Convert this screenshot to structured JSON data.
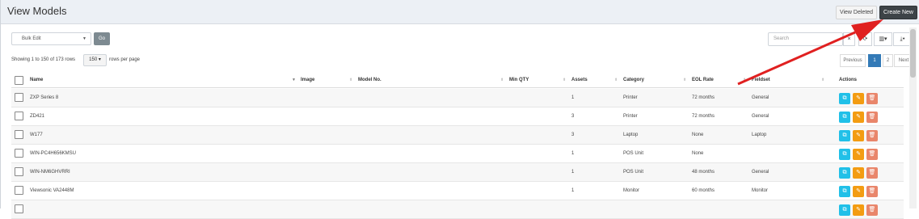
{
  "header": {
    "title": "View Models",
    "view_deleted": "View Deleted",
    "create_new": "Create New"
  },
  "toolbar": {
    "bulk_edit": "Bulk Edit",
    "go": "Go",
    "search_placeholder": "Search",
    "clear": "×",
    "refresh": "⟳",
    "columns": "▥▾",
    "export": "⤓▾"
  },
  "pagination": {
    "showing": "Showing 1 to 150 of 173 rows",
    "per_page_value": "150 ▾",
    "per_page_label": "rows per page",
    "previous": "Previous",
    "page_1": "1",
    "page_2": "2",
    "next": "Next"
  },
  "table": {
    "headers": [
      "Name",
      "Image",
      "Model No.",
      "Min QTY",
      "Assets",
      "Category",
      "EOL Rate",
      "Fieldset",
      "Actions"
    ],
    "rows": [
      {
        "name": "ZXP Series 8",
        "image": "",
        "model_no": "",
        "min_qty": "",
        "assets": "1",
        "category": "Printer",
        "eol": "72 months",
        "fieldset": "General"
      },
      {
        "name": "ZD421",
        "image": "",
        "model_no": "",
        "min_qty": "",
        "assets": "3",
        "category": "Printer",
        "eol": "72 months",
        "fieldset": "General"
      },
      {
        "name": "W177",
        "image": "",
        "model_no": "",
        "min_qty": "",
        "assets": "3",
        "category": "Laptop",
        "eol": "None",
        "fieldset": "Laptop"
      },
      {
        "name": "WIN-PC4H656KMSU",
        "image": "",
        "model_no": "",
        "min_qty": "",
        "assets": "1",
        "category": "POS Unit",
        "eol": "None",
        "fieldset": ""
      },
      {
        "name": "WIN-NM6GHVRRI",
        "image": "",
        "model_no": "",
        "min_qty": "",
        "assets": "1",
        "category": "POS Unit",
        "eol": "48 months",
        "fieldset": "General"
      },
      {
        "name": "Viewsonic VA2448M",
        "image": "",
        "model_no": "",
        "min_qty": "",
        "assets": "1",
        "category": "Monitor",
        "eol": "60 months",
        "fieldset": "Monitor"
      }
    ]
  },
  "action_icons": {
    "clone": "⧉",
    "edit": "✎",
    "delete": "🗑"
  },
  "colors": {
    "clone": "#21c0e8",
    "edit": "#f39c12",
    "delete": "#e9866b",
    "create_new": "#3d4347",
    "annotation_arrow": "#e02020"
  }
}
